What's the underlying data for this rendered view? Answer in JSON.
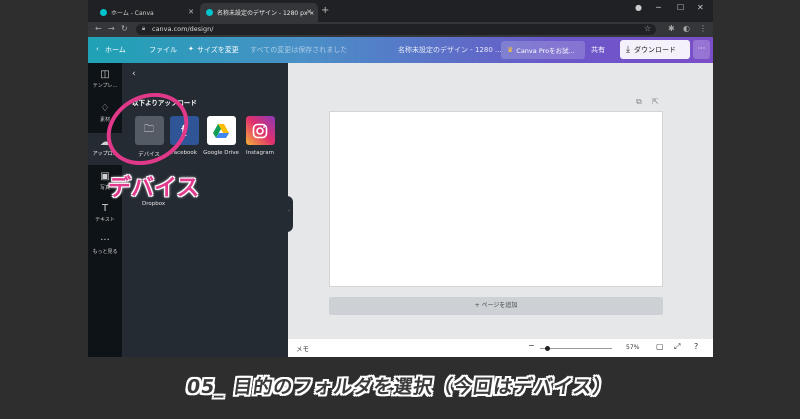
{
  "browser": {
    "tabs": [
      {
        "title": "ホーム - Canva"
      },
      {
        "title": "名称未設定のデザイン - 1280 px ×"
      }
    ],
    "new_tab": "+",
    "window_controls": {
      "minimize": "─",
      "maximize": "☐",
      "close": "✕"
    },
    "url": "canva.com/design/"
  },
  "header": {
    "home": "ホーム",
    "file": "ファイル",
    "resize": "サイズを変更",
    "saved_status": "すべての変更は保存されました",
    "doc_title": "名称未設定のデザイン - 1280 ...",
    "pro_button": "Canva Proをお試...",
    "share": "共有",
    "download": "ダウンロード",
    "more": "···"
  },
  "rail": {
    "items": [
      {
        "label": "テンプレ...",
        "icon": "template-icon"
      },
      {
        "label": "素材",
        "icon": "elements-icon"
      },
      {
        "label": "アップロ...",
        "icon": "upload-icon"
      },
      {
        "label": "写真",
        "icon": "photo-icon"
      },
      {
        "label": "テキスト",
        "icon": "text-icon"
      },
      {
        "label": "もっと見る",
        "icon": "more-icon"
      }
    ]
  },
  "panel": {
    "back": "‹",
    "title": "以下よりアップロード",
    "sources": [
      {
        "label": "デバイス",
        "icon": "folder-icon"
      },
      {
        "label": "Facebook",
        "icon": "facebook-icon"
      },
      {
        "label": "Google Drive",
        "icon": "google-drive-icon"
      },
      {
        "label": "Instagram",
        "icon": "instagram-icon"
      }
    ],
    "dropbox": "Dropbox"
  },
  "canvas": {
    "add_page": "+ ページを追加"
  },
  "bottombar": {
    "notes": "メモ",
    "zoom": "57%",
    "zoom_level": 0.57
  },
  "annotation": {
    "highlight_label": "デバイス",
    "caption": "05_ 目的のフォルダを選択（今回はデバイス）",
    "color": "#e23a8d"
  },
  "colors": {
    "header_start": "#1ea2b4",
    "header_end": "#7a4ec8",
    "rail_bg": "#0e1318",
    "panel_bg": "#252b33"
  }
}
